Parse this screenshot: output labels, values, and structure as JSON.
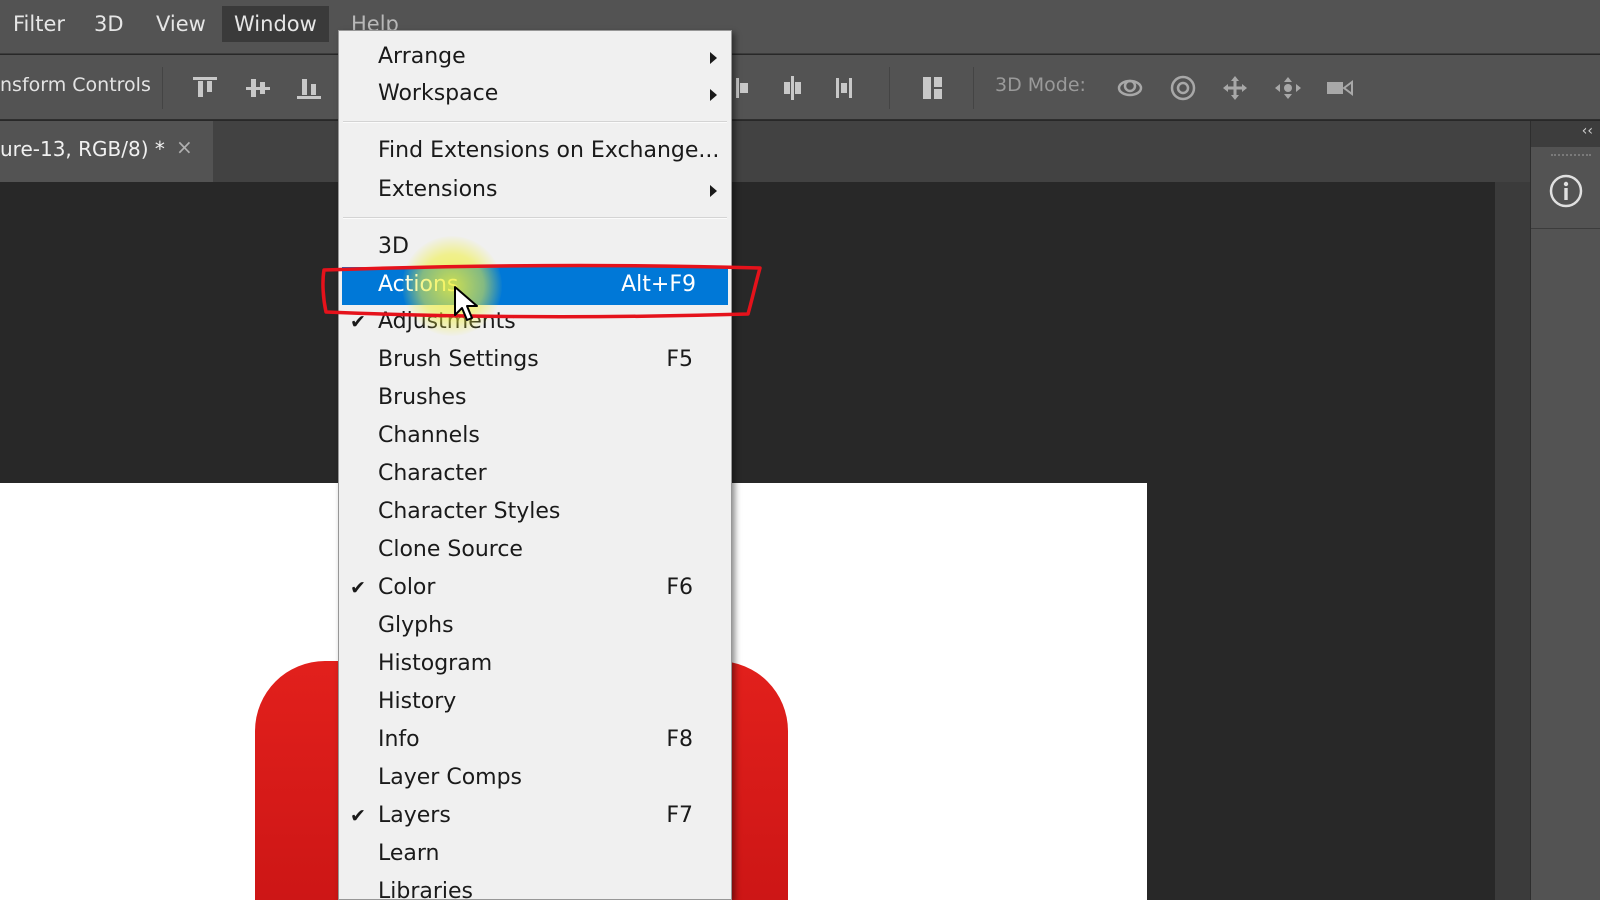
{
  "menubar": {
    "items": [
      {
        "label": "Filter"
      },
      {
        "label": "3D"
      },
      {
        "label": "View"
      },
      {
        "label": "Window"
      },
      {
        "label": "Help"
      }
    ]
  },
  "options_bar": {
    "transform_label": "nsform Controls",
    "mode_label": "3D Mode:"
  },
  "document_tab": {
    "title": "ure-13, RGB/8) *",
    "close": "×"
  },
  "right_panel": {
    "collapse": "‹‹",
    "icon": "info-icon"
  },
  "window_menu": {
    "items": [
      {
        "label": "Arrange",
        "submenu": true
      },
      {
        "label": "Workspace",
        "submenu": true
      },
      {
        "label": "Find Extensions on Exchange..."
      },
      {
        "label": "Extensions",
        "submenu": true
      },
      {
        "label": "3D"
      },
      {
        "label": "Actions",
        "shortcut": "Alt+F9",
        "highlighted": true
      },
      {
        "label": "Adjustments",
        "checked": true
      },
      {
        "label": "Brush Settings",
        "shortcut": "F5"
      },
      {
        "label": "Brushes"
      },
      {
        "label": "Channels"
      },
      {
        "label": "Character"
      },
      {
        "label": "Character Styles"
      },
      {
        "label": "Clone Source"
      },
      {
        "label": "Color",
        "shortcut": "F6",
        "checked": true
      },
      {
        "label": "Glyphs"
      },
      {
        "label": "Histogram"
      },
      {
        "label": "History"
      },
      {
        "label": "Info",
        "shortcut": "F8"
      },
      {
        "label": "Layer Comps"
      },
      {
        "label": "Layers",
        "shortcut": "F7",
        "checked": true
      },
      {
        "label": "Learn"
      },
      {
        "label": "Libraries"
      }
    ],
    "check_glyph": "✔"
  },
  "colors": {
    "highlight": "#0078d7",
    "annotation": "#e5121b",
    "cursor_glow": "#f0f03c",
    "menubar": "#535353",
    "canvas": "#282828"
  }
}
